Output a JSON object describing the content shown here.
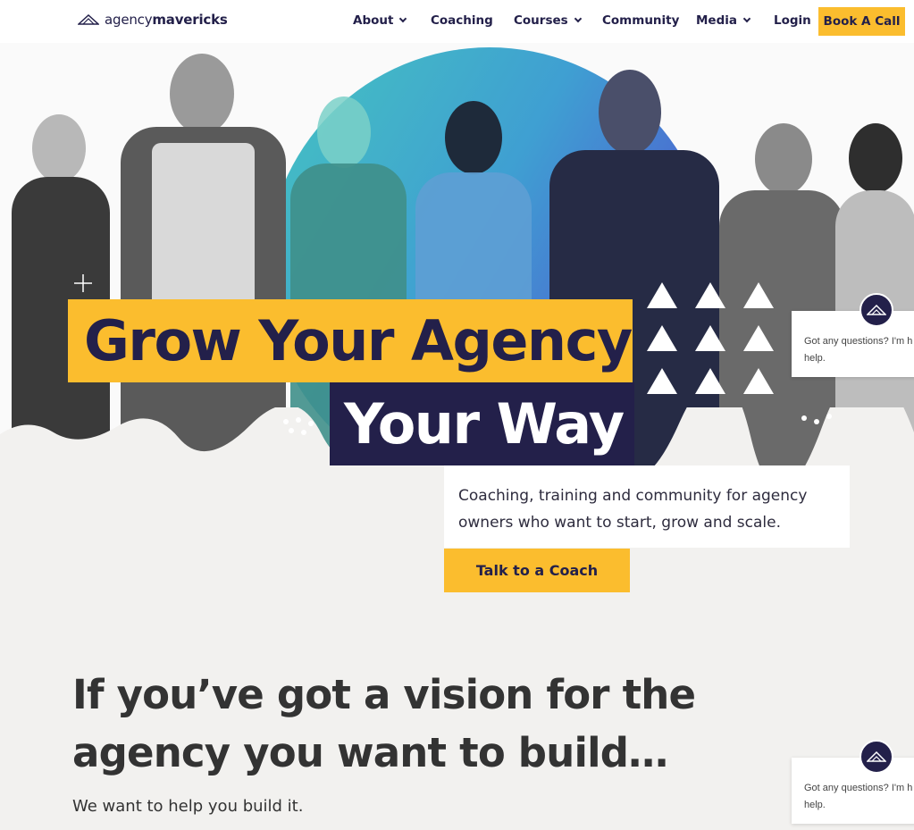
{
  "brand": {
    "logo_regular": "agency",
    "logo_bold": "mavericks"
  },
  "nav": {
    "items": [
      {
        "label": "About",
        "dropdown": true
      },
      {
        "label": "Coaching",
        "dropdown": false
      },
      {
        "label": "Courses",
        "dropdown": true
      },
      {
        "label": "Community",
        "dropdown": false
      },
      {
        "label": "Media",
        "dropdown": true
      },
      {
        "label": "Login",
        "dropdown": false
      }
    ],
    "cta": "Book A Call"
  },
  "hero": {
    "title_line1": "Grow Your Agency",
    "title_line2": "Your Way",
    "subtitle": "Coaching, training and community for agency owners who want to start, grow and scale.",
    "cta": "Talk to a Coach"
  },
  "vision": {
    "heading_line1": "If you’ve got a vision for the",
    "heading_line2": "agency you want to build…",
    "subheading": "We want to help you build it."
  },
  "chat_widget": {
    "line1": "Got any questions? I'm h",
    "line2": "help."
  },
  "colors": {
    "accent_yellow": "#fbbd2e",
    "navy": "#23204a",
    "page_background": "#f2f1ef"
  }
}
